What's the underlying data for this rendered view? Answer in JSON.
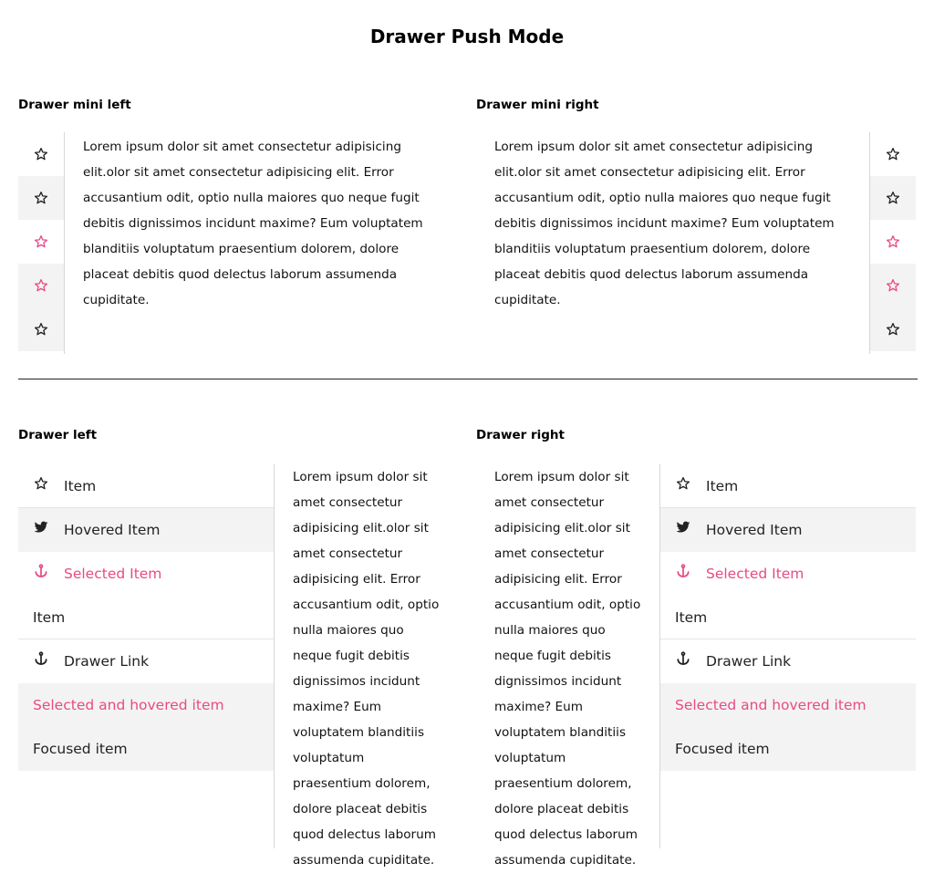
{
  "page": {
    "title": "Drawer Push Mode"
  },
  "colors": {
    "accent": "#e84a85",
    "hover_bg": "#f3f3f3",
    "border": "#d7d7d7",
    "text": "#222222"
  },
  "sections": {
    "mini_left": {
      "title": "Drawer mini left"
    },
    "mini_right": {
      "title": "Drawer mini right"
    },
    "left": {
      "title": "Drawer left"
    },
    "right": {
      "title": "Drawer right"
    }
  },
  "mini_rail": {
    "items": [
      {
        "icon": "star-outline-icon",
        "state": "normal"
      },
      {
        "icon": "star-outline-icon",
        "state": "hovered"
      },
      {
        "icon": "star-outline-icon",
        "state": "selected"
      },
      {
        "icon": "star-outline-icon",
        "state": "selected-hovered"
      },
      {
        "icon": "star-outline-icon",
        "state": "normal"
      }
    ]
  },
  "lorem": "Lorem ipsum dolor sit amet consectetur adipisicing elit.olor sit amet consectetur adipisicing elit. Error accusantium odit, optio nulla maiores quo neque fugit debitis dignissimos incidunt maxime? Eum voluptatem blanditiis voluptatum praesentium dolorem, dolore placeat debitis quod delectus laborum assumenda cupiditate.",
  "drawer_items": [
    {
      "label": "Item",
      "icon": "star-outline-icon",
      "state": "normal"
    },
    {
      "label": "Hovered Item",
      "icon": "twitter-icon",
      "state": "hovered"
    },
    {
      "label": "Selected Item",
      "icon": "anchor-icon",
      "state": "selected"
    },
    {
      "label": "Item",
      "icon": "",
      "state": "normal"
    },
    {
      "label": "Drawer Link",
      "icon": "anchor-icon",
      "state": "normal"
    },
    {
      "label": "Selected and hovered item",
      "icon": "",
      "state": "selected-hovered"
    },
    {
      "label": "Focused item",
      "icon": "",
      "state": "focused"
    }
  ]
}
